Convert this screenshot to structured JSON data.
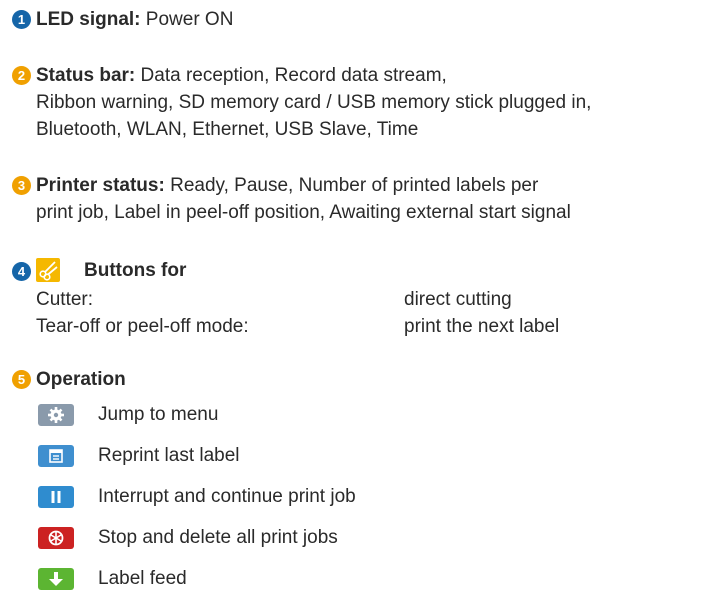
{
  "colors": {
    "badge_blue": "#1565a8",
    "badge_orange": "#f0a000",
    "menu_button": "#8a9aab",
    "reprint_button": "#3f8fcf",
    "pause_button": "#2f8ccf",
    "stop_button": "#cc2222",
    "feed_button": "#5cb532"
  },
  "item1": {
    "num": "1",
    "label": "LED signal:",
    "text": "Power ON"
  },
  "item2": {
    "num": "2",
    "label": "Status bar:",
    "line1": "Data reception, Record data stream,",
    "line2": "Ribbon warning, SD memory card / USB memory stick plugged in,",
    "line3": "Bluetooth, WLAN, Ethernet, USB Slave, Time"
  },
  "item3": {
    "num": "3",
    "label": "Printer status:",
    "line1": "Ready, Pause, Number of printed labels per",
    "line2": "print job, Label in peel-off position, Awaiting external start signal"
  },
  "item4": {
    "num": "4",
    "icon": "scissors-icon",
    "label": "Buttons for",
    "rows": [
      {
        "mode": "Cutter:",
        "action": "direct cutting"
      },
      {
        "mode": "Tear-off or peel-off mode:",
        "action": "print the next label"
      }
    ]
  },
  "item5": {
    "num": "5",
    "label": "Operation",
    "buttons": [
      {
        "icon": "gear-icon",
        "text": "Jump to menu"
      },
      {
        "icon": "reprint-icon",
        "text": "Reprint last label"
      },
      {
        "icon": "pause-icon",
        "text": "Interrupt and continue print job"
      },
      {
        "icon": "stop-icon",
        "text": "Stop and delete all print jobs"
      },
      {
        "icon": "down-arrow-icon",
        "text": "Label feed"
      }
    ]
  }
}
